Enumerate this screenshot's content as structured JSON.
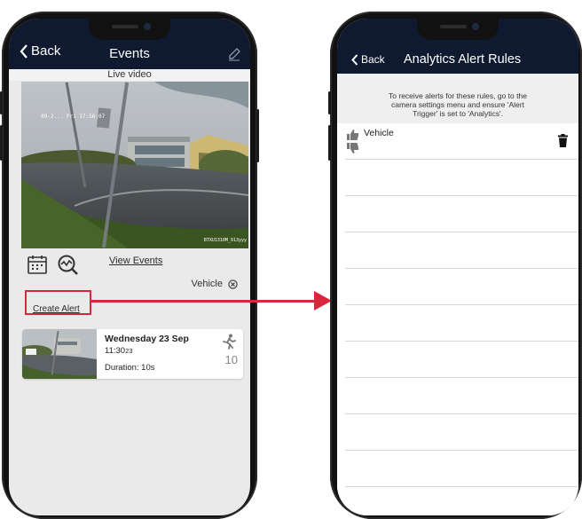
{
  "left_screen": {
    "nav": {
      "back_label": "Back",
      "title": "Events"
    },
    "live_video_label": "Live video",
    "video_overlay": {
      "timestamp": "09-2... Fri 17:56:07",
      "camera_name": "BTXU1310M_913yyy"
    },
    "view_events_label": "View Events",
    "filter": {
      "label": "Vehicle"
    },
    "create_alert_label": "Create Alert",
    "event": {
      "date": "Wednesday 23 Sep",
      "time": "11:30",
      "seconds": "23",
      "duration": "Duration: 10s",
      "count": "10"
    }
  },
  "right_screen": {
    "nav": {
      "back_label": "Back",
      "title": "Analytics Alert Rules"
    },
    "info_lines": [
      "To receive alerts for these rules, go to the",
      "camera settings menu and ensure 'Alert",
      "Trigger' is set to 'Analytics'."
    ],
    "rule": {
      "label": "Vehicle"
    }
  },
  "colors": {
    "nav_bg": "#0f1930",
    "highlight": "#d7263d",
    "screen_bg": "#eaeaea",
    "phone_frame": "#111111"
  },
  "icons": [
    "chevron-left-icon",
    "pencil-icon",
    "calendar-icon",
    "analytics-search-icon",
    "close-circle-icon",
    "running-person-icon",
    "thumbs-up-icon",
    "thumbs-down-icon",
    "trash-icon"
  ]
}
